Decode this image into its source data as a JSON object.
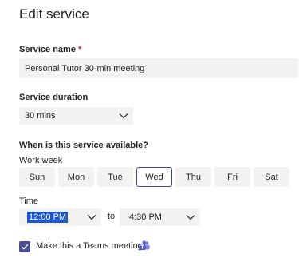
{
  "header": {
    "title": "Edit service"
  },
  "service_name": {
    "label": "Service name",
    "required_mark": "*",
    "value": "Personal Tutor 30-min meeting"
  },
  "duration": {
    "label": "Service duration",
    "value": "30 mins"
  },
  "availability": {
    "question": "When is this service available?",
    "work_week_label": "Work week",
    "days": [
      "Sun",
      "Mon",
      "Tue",
      "Wed",
      "Thu",
      "Fri",
      "Sat"
    ],
    "selected_day": "Wed"
  },
  "time": {
    "label": "Time",
    "start": "12:00 PM",
    "separator": "to",
    "end": "4:30 PM"
  },
  "teams": {
    "label": "Make this a Teams meeting",
    "checked": true,
    "icon": "teams-icon"
  },
  "colors": {
    "accent": "#444791",
    "field_bg": "#f3f2f1",
    "required": "#c4314b",
    "selection": "#1a56c9"
  }
}
